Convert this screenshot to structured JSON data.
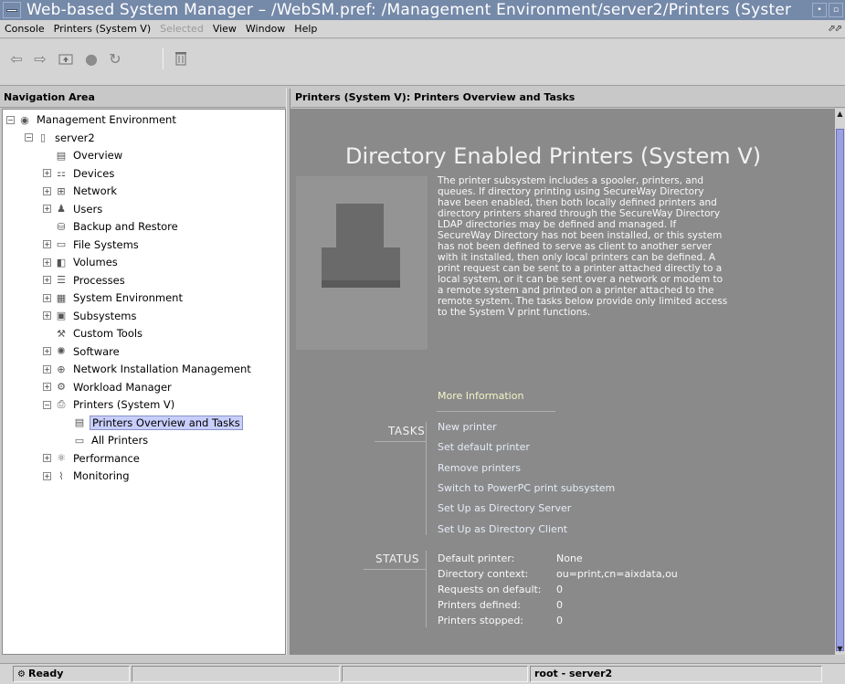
{
  "window": {
    "title": "Web-based System Manager – /WebSM.pref: /Management Environment/server2/Printers (Syster"
  },
  "menubar": {
    "items": [
      {
        "label": "Console",
        "enabled": true
      },
      {
        "label": "Printers (System V)",
        "enabled": true
      },
      {
        "label": "Selected",
        "enabled": false
      },
      {
        "label": "View",
        "enabled": true
      },
      {
        "label": "Window",
        "enabled": true
      },
      {
        "label": "Help",
        "enabled": true
      }
    ]
  },
  "toolbar": {
    "buttons": [
      {
        "name": "back-arrow-icon",
        "glyph": "⇦"
      },
      {
        "name": "forward-arrow-icon",
        "glyph": "⇨"
      },
      {
        "name": "up-folder-icon",
        "glyph": "⬚"
      },
      {
        "name": "stop-icon",
        "glyph": "●"
      },
      {
        "name": "refresh-icon",
        "glyph": "↻"
      },
      {
        "name": "trash-icon",
        "glyph": "🗑"
      }
    ]
  },
  "navigation": {
    "header": "Navigation Area",
    "tree": [
      {
        "label": "Management Environment",
        "level": 0,
        "expander": "−",
        "icon": "globe-icon"
      },
      {
        "label": "server2",
        "level": 1,
        "expander": "−",
        "icon": "server-icon"
      },
      {
        "label": "Overview",
        "level": 2,
        "expander": "",
        "icon": "overview-icon"
      },
      {
        "label": "Devices",
        "level": 2,
        "expander": "+",
        "icon": "devices-icon"
      },
      {
        "label": "Network",
        "level": 2,
        "expander": "+",
        "icon": "network-icon"
      },
      {
        "label": "Users",
        "level": 2,
        "expander": "+",
        "icon": "users-icon"
      },
      {
        "label": "Backup and Restore",
        "level": 2,
        "expander": "",
        "icon": "backup-icon"
      },
      {
        "label": "File Systems",
        "level": 2,
        "expander": "+",
        "icon": "folder-icon"
      },
      {
        "label": "Volumes",
        "level": 2,
        "expander": "+",
        "icon": "volumes-icon"
      },
      {
        "label": "Processes",
        "level": 2,
        "expander": "+",
        "icon": "processes-icon"
      },
      {
        "label": "System Environment",
        "level": 2,
        "expander": "+",
        "icon": "system-env-icon"
      },
      {
        "label": "Subsystems",
        "level": 2,
        "expander": "+",
        "icon": "subsystems-icon"
      },
      {
        "label": "Custom Tools",
        "level": 2,
        "expander": "",
        "icon": "tools-icon"
      },
      {
        "label": "Software",
        "level": 2,
        "expander": "+",
        "icon": "software-icon"
      },
      {
        "label": "Network Installation Management",
        "level": 2,
        "expander": "+",
        "icon": "nim-icon"
      },
      {
        "label": "Workload Manager",
        "level": 2,
        "expander": "+",
        "icon": "workload-icon"
      },
      {
        "label": "Printers (System V)",
        "level": 2,
        "expander": "−",
        "icon": "printer-icon"
      },
      {
        "label": "Printers Overview and Tasks",
        "level": 3,
        "expander": "",
        "icon": "overview-icon",
        "selected": true
      },
      {
        "label": "All Printers",
        "level": 3,
        "expander": "",
        "icon": "folder-icon"
      },
      {
        "label": "Performance",
        "level": 2,
        "expander": "+",
        "icon": "performance-icon"
      },
      {
        "label": "Monitoring",
        "level": 2,
        "expander": "+",
        "icon": "monitoring-icon"
      }
    ]
  },
  "content": {
    "header": "Printers (System V): Printers Overview and Tasks",
    "heading": "Directory Enabled Printers (System V)",
    "intro": "The printer subsystem includes a spooler, printers, and queues. If directory printing using SecureWay Directory have been enabled, then both locally defined printers and directory printers shared through the SecureWay Directory LDAP directories may be defined and managed. If SecureWay Directory has not been installed, or this system has not been defined to serve as client to another server with it installed, then only local printers can be defined. A print request can be sent to a printer attached directly to a local system, or it can be sent over a network or modem to a remote system and printed on a printer attached to the remote system. The tasks below provide only limited access to the System V print functions.",
    "more_info": "More Information",
    "tasks_label": "TASKS",
    "tasks": [
      "New printer",
      "Set default printer",
      "Remove printers",
      "Switch to PowerPC print subsystem",
      "Set Up as Directory Server",
      "Set Up as Directory Client"
    ],
    "status_label": "STATUS",
    "status": [
      {
        "label": "Default printer:",
        "value": "None"
      },
      {
        "label": "Directory context:",
        "value": "ou=print,cn=aixdata,ou"
      },
      {
        "label": "Requests on default:",
        "value": "0"
      },
      {
        "label": "Printers defined:",
        "value": "0"
      },
      {
        "label": "Printers stopped:",
        "value": "0"
      }
    ]
  },
  "statusbar": {
    "state": "Ready",
    "user": "root - server2"
  }
}
